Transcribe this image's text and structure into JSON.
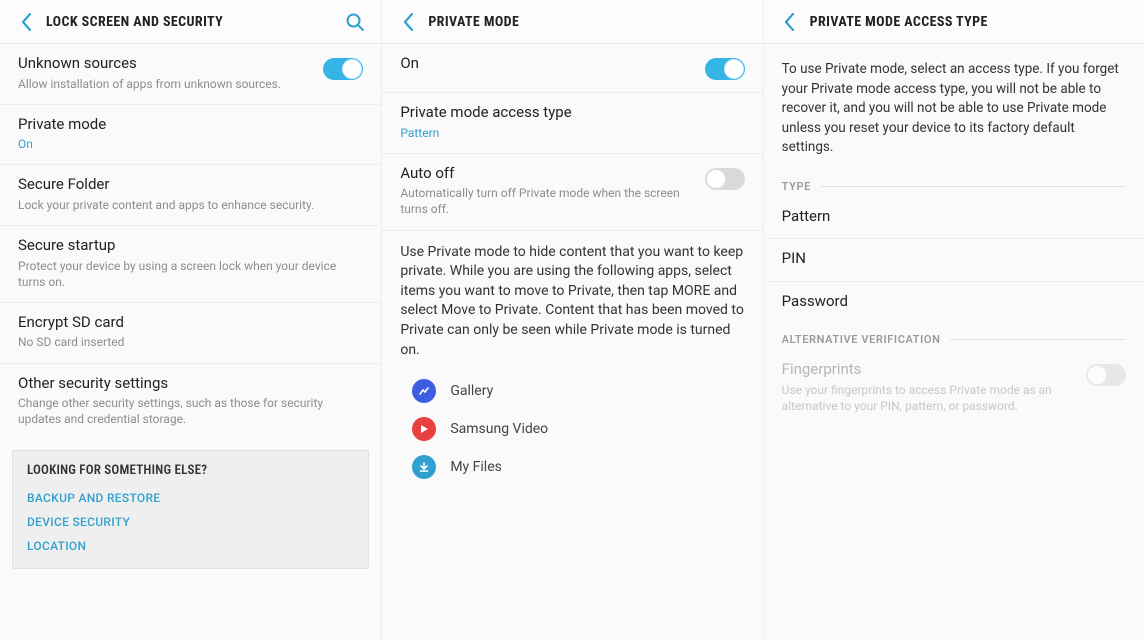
{
  "colors": {
    "accent": "#2fa0cf"
  },
  "screen1": {
    "header": {
      "title": "LOCK SCREEN AND SECURITY"
    },
    "rows": {
      "unknown_sources": {
        "title": "Unknown sources",
        "sub": "Allow installation of apps from unknown sources.",
        "toggle": "on"
      },
      "private_mode": {
        "title": "Private mode",
        "sub": "On"
      },
      "secure_folder": {
        "title": "Secure Folder",
        "sub": "Lock your private content and apps to enhance security."
      },
      "secure_startup": {
        "title": "Secure startup",
        "sub": "Protect your device by using a screen lock when your device turns on."
      },
      "encrypt_sd": {
        "title": "Encrypt SD card",
        "sub": "No SD card inserted"
      },
      "other_security": {
        "title": "Other security settings",
        "sub": "Change other security settings, such as those for security updates and credential storage."
      }
    },
    "footer": {
      "heading": "LOOKING FOR SOMETHING ELSE?",
      "links": [
        "BACKUP AND RESTORE",
        "DEVICE SECURITY",
        "LOCATION"
      ]
    }
  },
  "screen2": {
    "header": {
      "title": "PRIVATE MODE"
    },
    "rows": {
      "on": {
        "title": "On",
        "toggle": "on"
      },
      "access_type": {
        "title": "Private mode access type",
        "sub": "Pattern"
      },
      "auto_off": {
        "title": "Auto off",
        "sub": "Automatically turn off Private mode when the screen turns off.",
        "toggle": "off"
      }
    },
    "explanation": "Use Private mode to hide content that you want to keep private. While you are using the following apps, select items you want to move to Private, then tap MORE and select Move to Private. Content that has been moved to Private can only be seen while Private mode is turned on.",
    "apps": [
      "Gallery",
      "Samsung Video",
      "My Files"
    ]
  },
  "screen3": {
    "header": {
      "title": "PRIVATE MODE ACCESS TYPE"
    },
    "intro": "To use Private mode, select an access type. If you forget your Private mode access type, you will not be able to recover it, and you will not be able to use Private mode unless you reset your device to its factory default settings.",
    "section_type": "TYPE",
    "options": [
      "Pattern",
      "PIN",
      "Password"
    ],
    "section_alt": "ALTERNATIVE VERIFICATION",
    "fingerprints": {
      "title": "Fingerprints",
      "sub": "Use your fingerprints to access Private mode as an alternative to your PIN, pattern, or password.",
      "toggle": "off"
    }
  }
}
